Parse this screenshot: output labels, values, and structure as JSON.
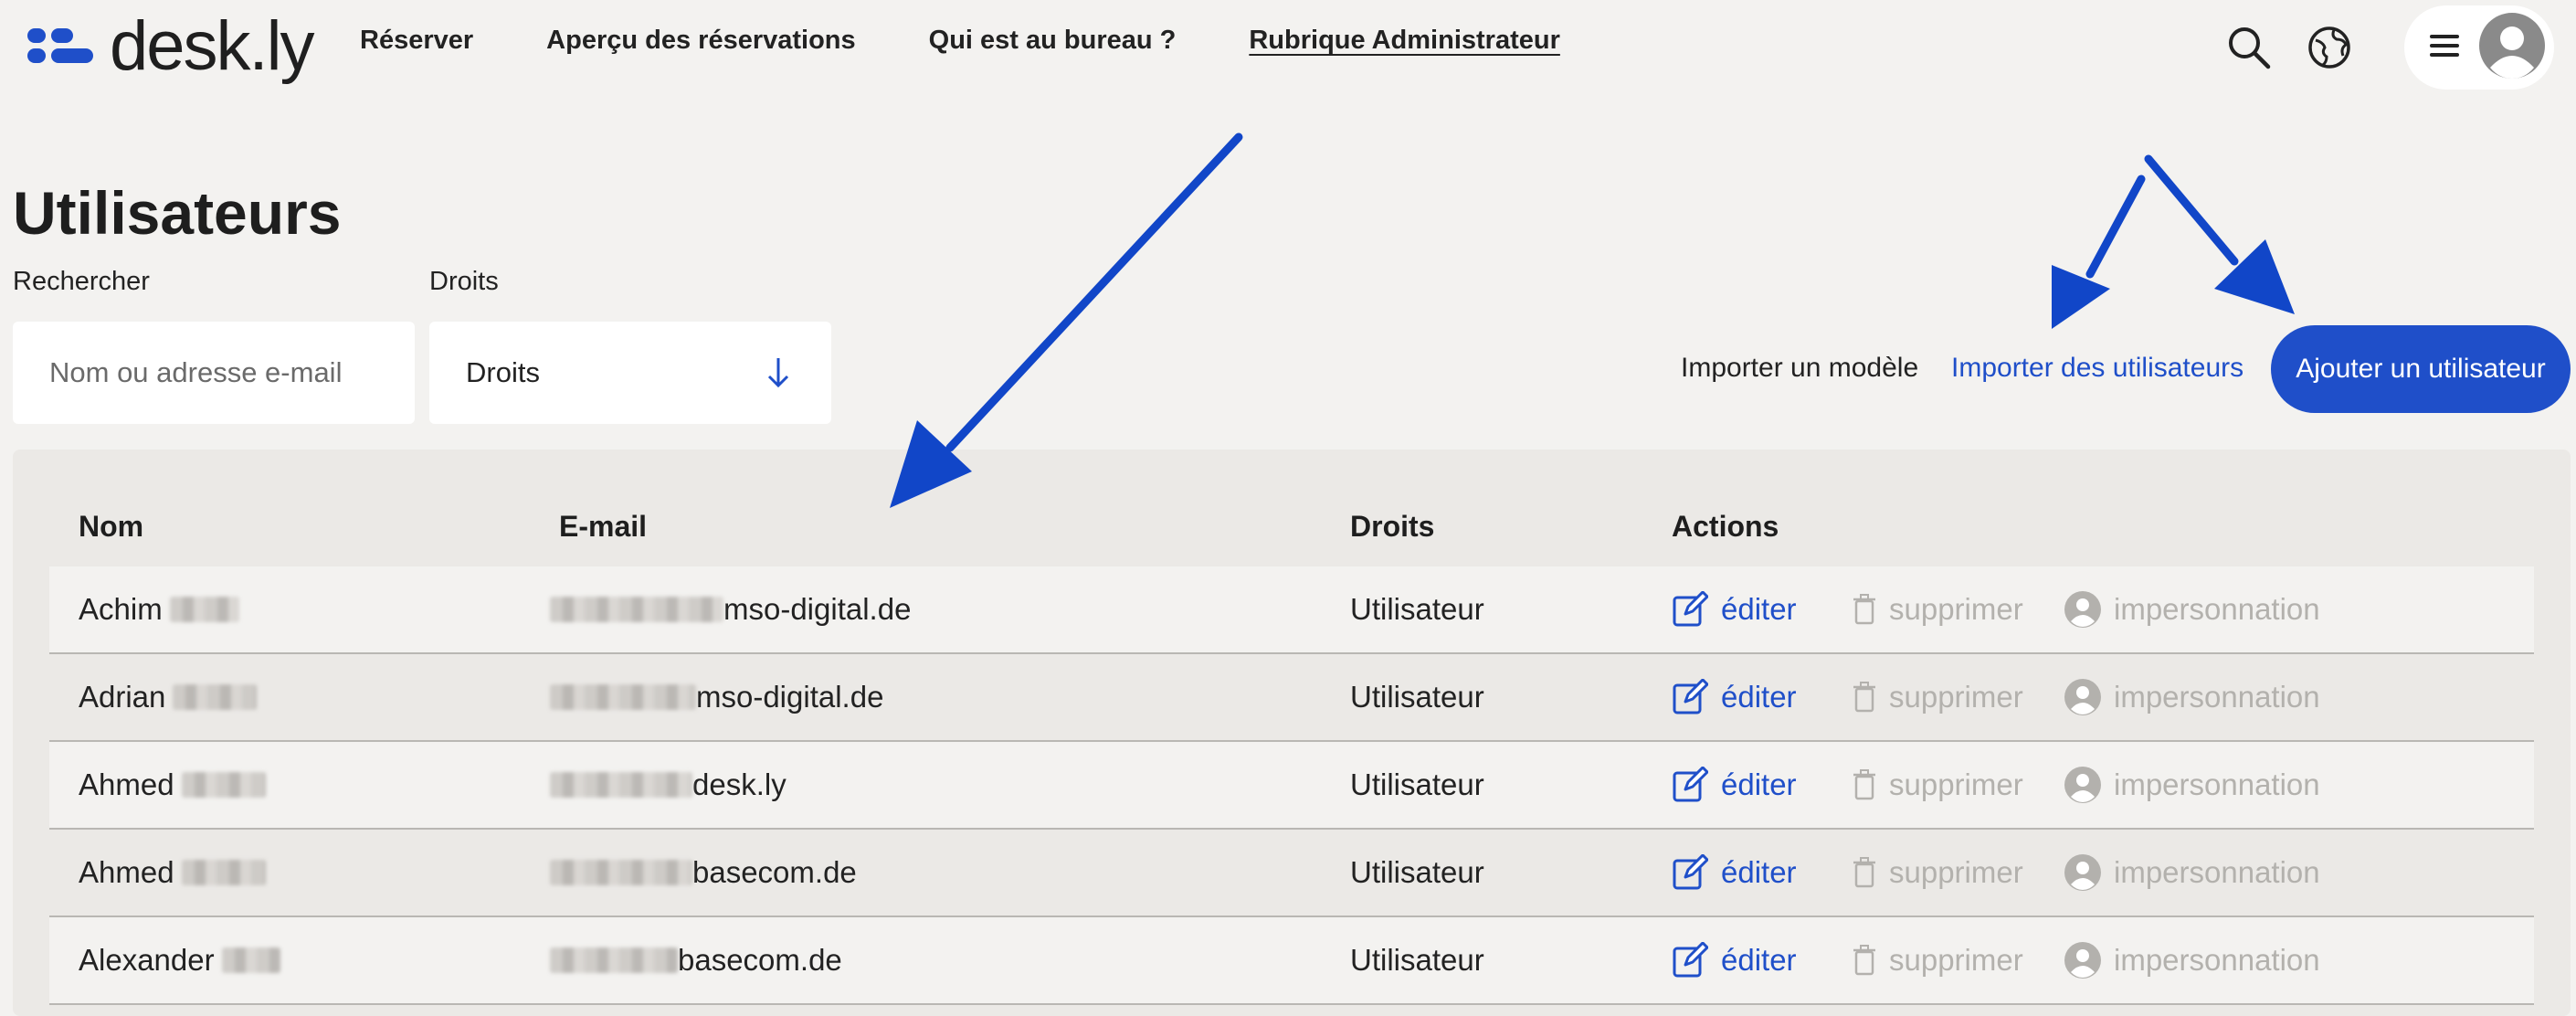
{
  "brand": {
    "name": "desk.ly",
    "color": "#1f4fc9"
  },
  "nav": {
    "items": [
      {
        "label": "Réserver"
      },
      {
        "label": "Aperçu des réservations"
      },
      {
        "label": "Qui est au bureau ?"
      },
      {
        "label": "Rubrique Administrateur",
        "active": true
      }
    ]
  },
  "header_icons": [
    "search-icon",
    "globe-icon",
    "menu-icon",
    "avatar-icon"
  ],
  "page": {
    "title": "Utilisateurs"
  },
  "filters": {
    "search_label": "Rechercher",
    "search_placeholder": "Nom ou adresse e-mail",
    "rights_label": "Droits",
    "rights_value": "Droits"
  },
  "actions": {
    "import_template": "Importer un modèle",
    "import_users": "Importer des utilisateurs",
    "add_user": "Ajouter un utilisateur"
  },
  "table": {
    "headers": {
      "name": "Nom",
      "email": "E-mail",
      "rights": "Droits",
      "actions": "Actions"
    },
    "action_labels": {
      "edit": "éditer",
      "delete": "supprimer",
      "impersonate": "impersonnation"
    },
    "rows": [
      {
        "first_name": "Achim",
        "email_domain": "mso-digital.de",
        "rights": "Utilisateur"
      },
      {
        "first_name": "Adrian",
        "email_domain": "mso-digital.de",
        "rights": "Utilisateur"
      },
      {
        "first_name": "Ahmed",
        "email_domain": "desk.ly",
        "rights": "Utilisateur"
      },
      {
        "first_name": "Ahmed",
        "email_domain": "basecom.de",
        "rights": "Utilisateur"
      },
      {
        "first_name": "Alexander",
        "email_domain": "basecom.de",
        "rights": "Utilisateur"
      }
    ]
  },
  "colors": {
    "accent": "#1f4fc9",
    "background": "#f3f2f0",
    "muted": "#b3b1ad"
  }
}
